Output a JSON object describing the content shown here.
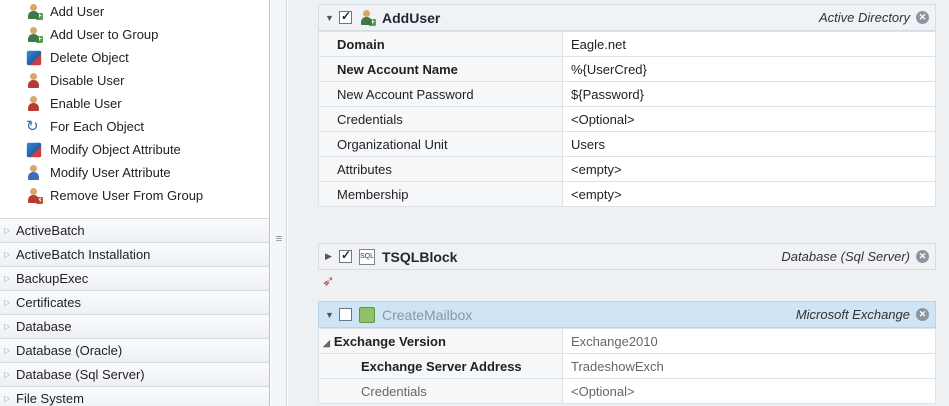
{
  "actions": [
    {
      "label": "Add User",
      "icon": "user-add-icon"
    },
    {
      "label": "Add User to Group",
      "icon": "user-group-add-icon"
    },
    {
      "label": "Delete Object",
      "icon": "delete-object-icon"
    },
    {
      "label": "Disable User",
      "icon": "user-disable-icon"
    },
    {
      "label": "Enable User",
      "icon": "user-enable-icon"
    },
    {
      "label": "For Each Object",
      "icon": "loop-icon"
    },
    {
      "label": "Modify Object Attribute",
      "icon": "object-edit-icon"
    },
    {
      "label": "Modify User Attribute",
      "icon": "user-edit-icon"
    },
    {
      "label": "Remove User From Group",
      "icon": "user-remove-icon"
    }
  ],
  "categories": [
    "ActiveBatch",
    "ActiveBatch Installation",
    "BackupExec",
    "Certificates",
    "Database",
    "Database (Oracle)",
    "Database (Sql Server)",
    "File System"
  ],
  "steps": {
    "adduser": {
      "title": "AddUser",
      "category": "Active Directory",
      "checked": true,
      "rows": [
        {
          "label": "Domain",
          "value": "Eagle.net",
          "bold": true
        },
        {
          "label": "New Account Name",
          "value": "%{UserCred}",
          "bold": true
        },
        {
          "label": "New Account Password",
          "value": "${Password}",
          "bold": false
        },
        {
          "label": "Credentials",
          "value": "<Optional>",
          "bold": false
        },
        {
          "label": "Organizational Unit",
          "value": "Users",
          "bold": false
        },
        {
          "label": "Attributes",
          "value": "<empty>",
          "bold": false
        },
        {
          "label": "Membership",
          "value": "<empty>",
          "bold": false
        }
      ]
    },
    "tsql": {
      "title": "TSQLBlock",
      "category": "Database (Sql Server)",
      "checked": true
    },
    "mailbox": {
      "title": "CreateMailbox",
      "category": "Microsoft Exchange",
      "checked": false,
      "group_label": "Exchange Version",
      "group_value": "Exchange2010",
      "rows": [
        {
          "label": "Exchange Server Address",
          "value": "TradeshowExch"
        },
        {
          "label": "Credentials",
          "value": "<Optional>"
        }
      ]
    }
  },
  "colors": {
    "selected_header": "#cfe4f4",
    "workspace_bg": "#eef1f4"
  }
}
